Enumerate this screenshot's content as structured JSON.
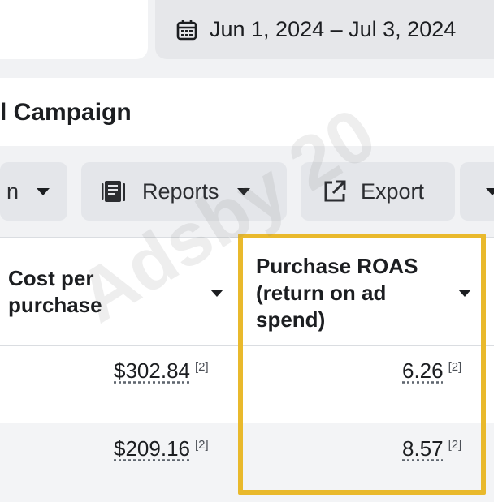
{
  "date_range": {
    "label": "Jun 1, 2024 – Jul 3, 2024",
    "icon": "calendar-icon"
  },
  "page_title": "l Campaign",
  "toolbar": {
    "partial_label": "n",
    "reports_label": "Reports",
    "export_label": "Export"
  },
  "table": {
    "columns": [
      {
        "label": "Cost per purchase"
      },
      {
        "label": "Purchase ROAS (return on ad spend)"
      }
    ],
    "rows": [
      {
        "cost_per_purchase": "$302.84",
        "cpp_note": "[2]",
        "roas": "6.26",
        "roas_note": "[2]"
      },
      {
        "cost_per_purchase": "$209.16",
        "cpp_note": "[2]",
        "roas": "8.57",
        "roas_note": "[2]"
      }
    ]
  },
  "watermark": "Adsby 20",
  "colors": {
    "highlight": "#e9b92c",
    "button_bg": "#e4e6ea"
  }
}
